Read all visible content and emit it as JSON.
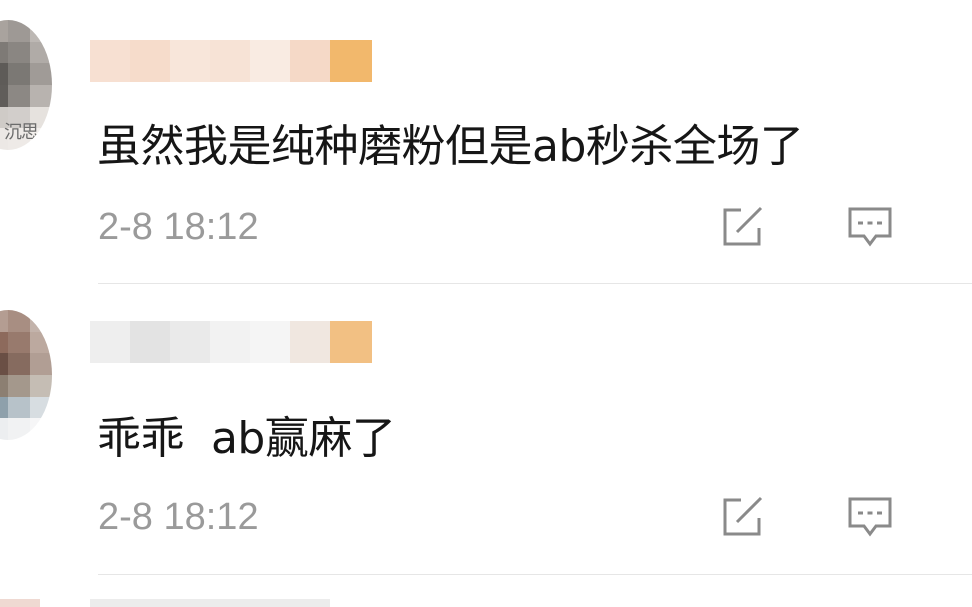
{
  "comments": [
    {
      "text": "虽然我是纯种磨粉但是ab秒杀全场了",
      "time": "2-8 18:12",
      "avatar_overlay_text": "沉思",
      "share_icon": "share-edit-icon",
      "reply_icon": "comment-bubble-icon"
    },
    {
      "text": "乖乖  ab赢麻了",
      "time": "2-8 18:12",
      "share_icon": "share-edit-icon",
      "reply_icon": "comment-bubble-icon"
    }
  ],
  "colors": {
    "text": "#161616",
    "meta": "#9a9a9a",
    "icon": "#8a8a8a",
    "divider": "#e6e6e6",
    "username_blur_light": "#f6dccb",
    "username_blur_accent": "#f2b86c"
  }
}
